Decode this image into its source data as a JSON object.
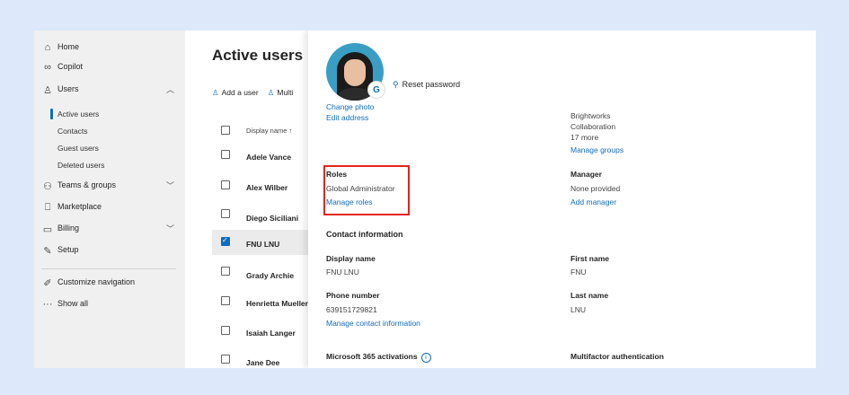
{
  "sidebar": {
    "items": [
      {
        "label": "Home"
      },
      {
        "label": "Copilot"
      },
      {
        "label": "Users"
      },
      {
        "label": "Teams & groups"
      },
      {
        "label": "Marketplace"
      },
      {
        "label": "Billing"
      },
      {
        "label": "Setup"
      },
      {
        "label": "Customize navigation"
      },
      {
        "label": "Show all"
      }
    ],
    "users_sub": [
      "Active users",
      "Contacts",
      "Guest users",
      "Deleted users"
    ]
  },
  "main": {
    "title": "Active users",
    "toolbar": {
      "add_user": "Add a user",
      "multi": "Multi"
    },
    "column_header": "Display name ↑",
    "users": [
      "Adele Vance",
      "Alex Wilber",
      "Diego Siciliani",
      "FNU LNU",
      "Grady Archie",
      "Henrietta Mueller",
      "Isaiah Langer",
      "Jane Dee"
    ]
  },
  "panel": {
    "reset_password": "Reset password",
    "change_photo": "Change photo",
    "edit_address": "Edit address",
    "groups": [
      "Brightworks",
      "Collaboration",
      "17 more"
    ],
    "manage_groups": "Manage groups",
    "roles_label": "Roles",
    "roles_value": "Global Administrator",
    "manage_roles": "Manage roles",
    "manager_label": "Manager",
    "manager_value": "None provided",
    "add_manager": "Add manager",
    "contact_heading": "Contact information",
    "display_name_label": "Display name",
    "display_name_value": "FNU LNU",
    "first_name_label": "First name",
    "first_name_value": "FNU",
    "phone_label": "Phone number",
    "phone_value": "639151729821",
    "manage_contact": "Manage contact information",
    "last_name_label": "Last name",
    "last_name_value": "LNU",
    "ms365_label": "Microsoft 365 activations",
    "mfa_label": "Multifactor authentication"
  },
  "selected_user": "FNU LNU"
}
